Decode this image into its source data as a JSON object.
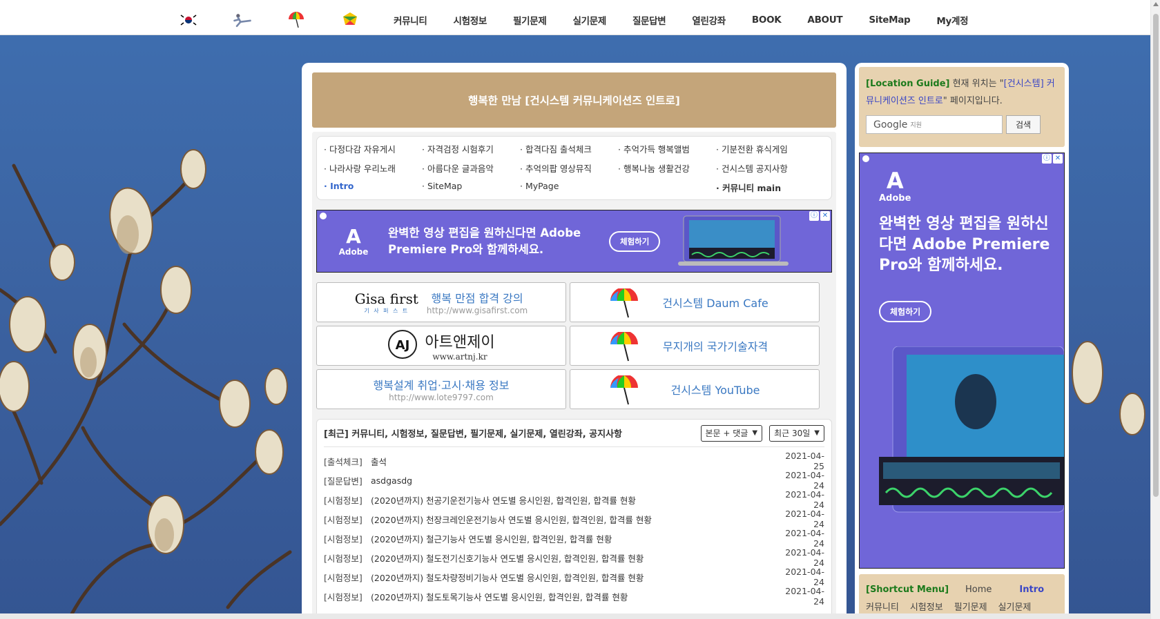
{
  "nav": {
    "icons": [
      "korea-flag-icon",
      "taekwondo-icon",
      "umbrella-icon",
      "flower-icon"
    ],
    "links": [
      "커뮤니티",
      "시험정보",
      "필기문제",
      "실기문제",
      "질문답변",
      "열린강좌",
      "BOOK",
      "ABOUT",
      "SiteMap",
      "My계정"
    ]
  },
  "main": {
    "title": "행복한 만남 [건시스템 커뮤니케이션즈 인트로]",
    "links": [
      "· 다정다감 자유게시",
      "· 자격검정 시험후기",
      "· 합격다짐 출석체크",
      "· 추억가득 행복앨범",
      "· 기분전환 휴식게임",
      "· 나라사랑 우리노래",
      "· 아름다운 글과음악",
      "· 추억의팝 영상뮤직",
      "· 행복나눔 생활건강",
      "· 건시스템 공지사항",
      "· Intro",
      "· SiteMap",
      "· MyPage",
      "",
      "· 커뮤니티 main"
    ],
    "ad": {
      "brand": "Adobe",
      "text": "완벽한 영상 편집을 원하신다면 Adobe Premiere Pro와 함께하세요.",
      "cta": "체험하기"
    },
    "tiles": {
      "gisa_title": "행복 만점 합격 강의",
      "gisa_url": "http://www.gisafirst.com",
      "gisa_logo": "Gisa first",
      "gisa_logo_sub": "기 사 퍼 스 트",
      "daum": "건시스템 Daum Cafe",
      "artnj_name": "아트앤제이",
      "artnj_url": "www.artnj.kr",
      "rainbow": "무지개의 국가기술자격",
      "lote_title": "행복설계 취업·고시·채용 정보",
      "lote_url": "http://www.lote9797.com",
      "youtube": "건시스템 YouTube"
    },
    "recent": {
      "title": "[최근] 커뮤니티, 시험정보, 질문답변, 필기문제, 실기문제, 열린강좌, 공지사항",
      "select1": "본문 + 댓글",
      "select2": "최근 30일",
      "rows": [
        {
          "cat": "[출석체크]",
          "subj": "출석",
          "date": "2021-04-25"
        },
        {
          "cat": "[질문답변]",
          "subj": "asdgasdg",
          "date": "2021-04-24"
        },
        {
          "cat": "[시험정보]",
          "subj": "(2020년까지) 천공기운전기능사 연도별 응시인원, 합격인원, 합격률 현황",
          "date": "2021-04-24"
        },
        {
          "cat": "[시험정보]",
          "subj": "(2020년까지) 천장크레인운전기능사 연도별 응시인원, 합격인원, 합격률 현황",
          "date": "2021-04-24"
        },
        {
          "cat": "[시험정보]",
          "subj": "(2020년까지) 철근기능사 연도별 응시인원, 합격인원, 합격률 현황",
          "date": "2021-04-24"
        },
        {
          "cat": "[시험정보]",
          "subj": "(2020년까지) 철도전기신호기능사 연도별 응시인원, 합격인원, 합격률 현황",
          "date": "2021-04-24"
        },
        {
          "cat": "[시험정보]",
          "subj": "(2020년까지) 철도차량정비기능사 연도별 응시인원, 합격인원, 합격률 현황",
          "date": "2021-04-24"
        },
        {
          "cat": "[시험정보]",
          "subj": "(2020년까지) 철도토목기능사 연도별 응시인원, 합격인원, 합격률 현황",
          "date": "2021-04-24"
        }
      ]
    }
  },
  "side": {
    "loc_guide_label": "[Location Guide]",
    "loc_prefix": " 현재 위치는 \"",
    "loc_page": "[건시스템] 커뮤니케이션즈 인트로",
    "loc_suffix": "\" 페이지입니다.",
    "google_label": "Google",
    "google_small": "지원",
    "search_btn": "검색",
    "ad": {
      "brand": "Adobe",
      "text": "완벽한 영상 편집을 원하신다면 Adobe Premiere Pro와 함께하세요.",
      "cta": "체험하기"
    },
    "shortcut_label": "[Shortcut Menu]",
    "shortcut_row1": [
      "Home",
      "Intro"
    ],
    "shortcut_row2": [
      "커뮤니티",
      "시험정보",
      "필기문제",
      "실기문제"
    ]
  },
  "colors": {
    "title_bar": "#c4a57a",
    "side_box": "#e7d2b0",
    "ad_purple": "#7066d8",
    "link_blue": "#3a78c2"
  }
}
